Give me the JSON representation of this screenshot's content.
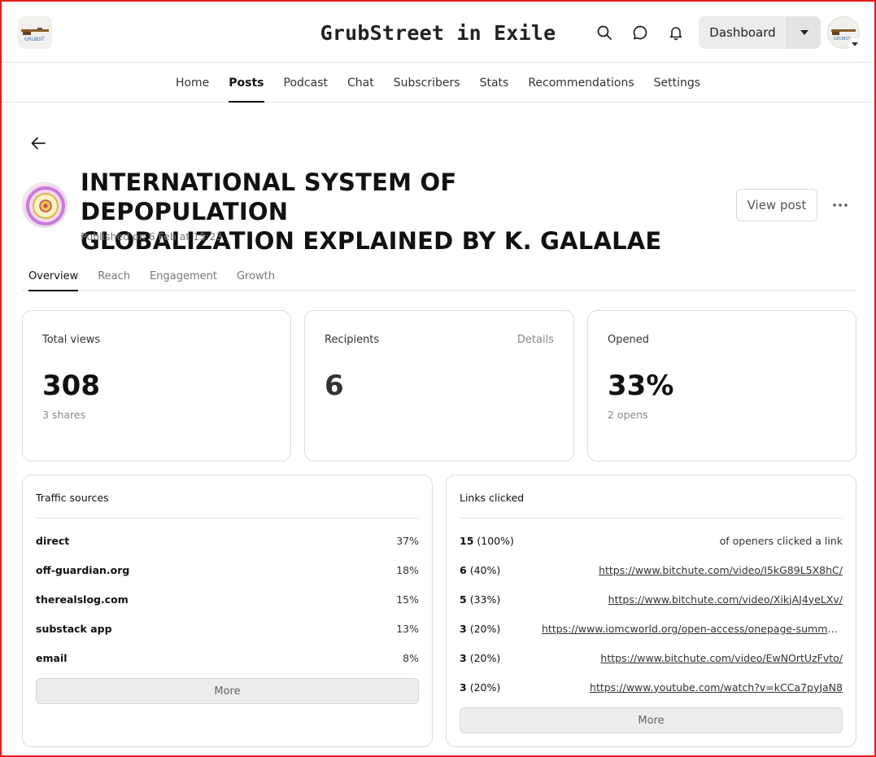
{
  "header": {
    "site_title": "GrubStreet in Exile",
    "logo_icon": "rifle-logo-icon",
    "dashboard_label": "Dashboard"
  },
  "nav": {
    "items": [
      {
        "label": "Home",
        "active": false
      },
      {
        "label": "Posts",
        "active": true
      },
      {
        "label": "Podcast",
        "active": false
      },
      {
        "label": "Chat",
        "active": false
      },
      {
        "label": "Subscribers",
        "active": false
      },
      {
        "label": "Stats",
        "active": false
      },
      {
        "label": "Recommendations",
        "active": false
      },
      {
        "label": "Settings",
        "active": false
      }
    ]
  },
  "post": {
    "title_line1": "INTERNATIONAL SYSTEM OF DEPOPULATION",
    "title_line2": "GLOBALIZATION EXPLAINED BY K. GALALAE",
    "published": "Published on 6 Feb at 15:23",
    "view_post_label": "View post"
  },
  "tabs": [
    {
      "label": "Overview",
      "active": true
    },
    {
      "label": "Reach",
      "active": false
    },
    {
      "label": "Engagement",
      "active": false
    },
    {
      "label": "Growth",
      "active": false
    }
  ],
  "stats": {
    "total_views": {
      "label": "Total views",
      "value": "308",
      "sub": "3 shares"
    },
    "recipients": {
      "label": "Recipients",
      "value": "6",
      "details": "Details"
    },
    "opened": {
      "label": "Opened",
      "value": "33%",
      "sub": "2 opens"
    }
  },
  "traffic": {
    "title": "Traffic sources",
    "rows": [
      {
        "name": "direct",
        "pct": "37%"
      },
      {
        "name": "off-guardian.org",
        "pct": "18%"
      },
      {
        "name": "therealslog.com",
        "pct": "15%"
      },
      {
        "name": "substack app",
        "pct": "13%"
      },
      {
        "name": "email",
        "pct": "8%"
      }
    ],
    "more_label": "More"
  },
  "links": {
    "title": "Links clicked",
    "rows": [
      {
        "count": "15",
        "pct": "(100%)",
        "text": "of openers clicked a link",
        "is_link": false
      },
      {
        "count": "6",
        "pct": "(40%)",
        "text": "https://www.bitchute.com/video/I5kG89L5X8hC/",
        "is_link": true
      },
      {
        "count": "5",
        "pct": "(33%)",
        "text": "https://www.bitchute.com/video/XikjAJ4yeLXv/",
        "is_link": true
      },
      {
        "count": "3",
        "pct": "(20%)",
        "text": "https://www.iomcworld.org/open-access/onepage-summary-",
        "is_link": true
      },
      {
        "count": "3",
        "pct": "(20%)",
        "text": "https://www.bitchute.com/video/EwNOrtUzFvto/",
        "is_link": true
      },
      {
        "count": "3",
        "pct": "(20%)",
        "text": "https://www.youtube.com/watch?v=kCCa7pyJaN8",
        "is_link": true
      }
    ],
    "more_label": "More"
  },
  "colors": {
    "frame_red": "#e41e1e",
    "button_gray": "#ececec",
    "text_dark": "#111111"
  }
}
